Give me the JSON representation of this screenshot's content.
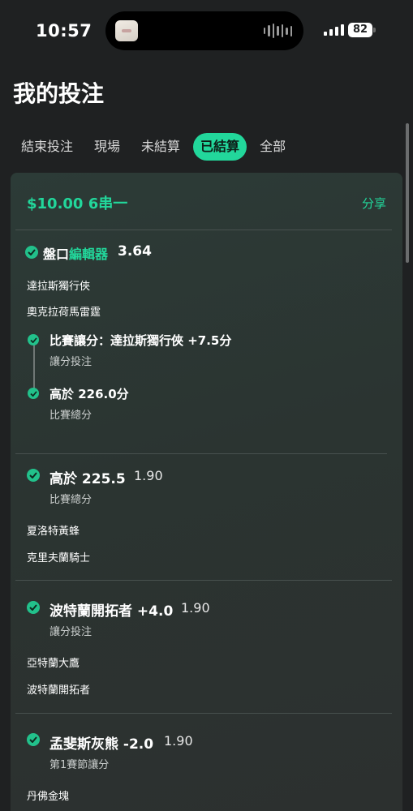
{
  "status": {
    "time": "10:57",
    "battery": "82"
  },
  "page_title": "我的投注",
  "tabs": [
    "結束投注",
    "現場",
    "未結算",
    "已結算",
    "全部"
  ],
  "active_tab": "已結算",
  "bet": {
    "stake_label": "$10.00 6串一",
    "share_label": "分享",
    "legs": [
      {
        "title_prefix": "盤口",
        "title_highlight": "編輯器",
        "odds": "3.64",
        "teams": [
          "達拉斯獨行俠",
          "奧克拉荷馬雷霆"
        ],
        "sub_legs": [
          {
            "title": "比賽讓分：達拉斯獨行俠 +7.5分",
            "market": "讓分投注"
          },
          {
            "title": "高於 226.0分",
            "market": "比賽總分"
          }
        ]
      },
      {
        "title": "高於 225.5",
        "odds": "1.90",
        "market": "比賽總分",
        "teams": [
          "夏洛特黃蜂",
          "克里夫蘭騎士"
        ]
      },
      {
        "title": "波特蘭開拓者 +4.0",
        "odds": "1.90",
        "market": "讓分投注",
        "teams": [
          "亞特蘭大鷹",
          "波特蘭開拓者"
        ]
      },
      {
        "title": "孟斐斯灰熊 -2.0",
        "odds": "1.90",
        "market": "第1賽節讓分",
        "teams": [
          "丹佛金塊"
        ]
      }
    ]
  },
  "colors": {
    "accent": "#22d79b",
    "background": "#1f2122",
    "card": "#2c3b37"
  }
}
